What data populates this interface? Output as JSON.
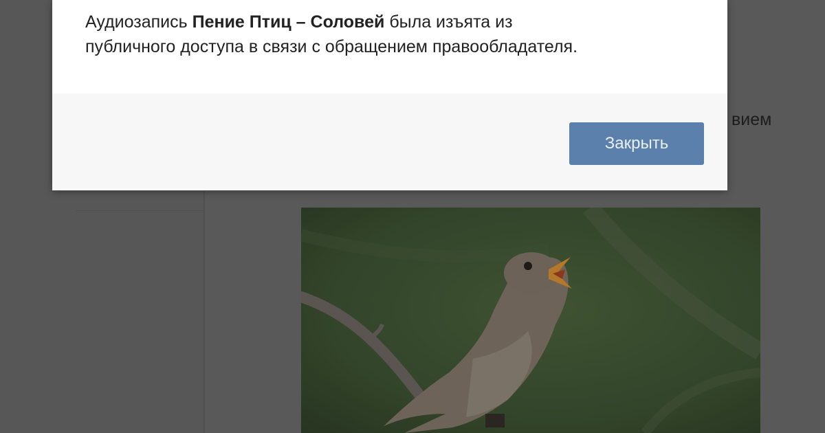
{
  "modal": {
    "message_prefix": "Аудиозапись ",
    "track_title": "Пение Птиц – Соловей",
    "message_line1_suffix": " была изъята из",
    "message_line2": "публичного доступа в связи с обращением правообладателя.",
    "close_label": "Закрыть"
  },
  "background": {
    "text_fragment": "вием"
  },
  "colors": {
    "button": "#5b80ab",
    "overlay": "#595959"
  }
}
